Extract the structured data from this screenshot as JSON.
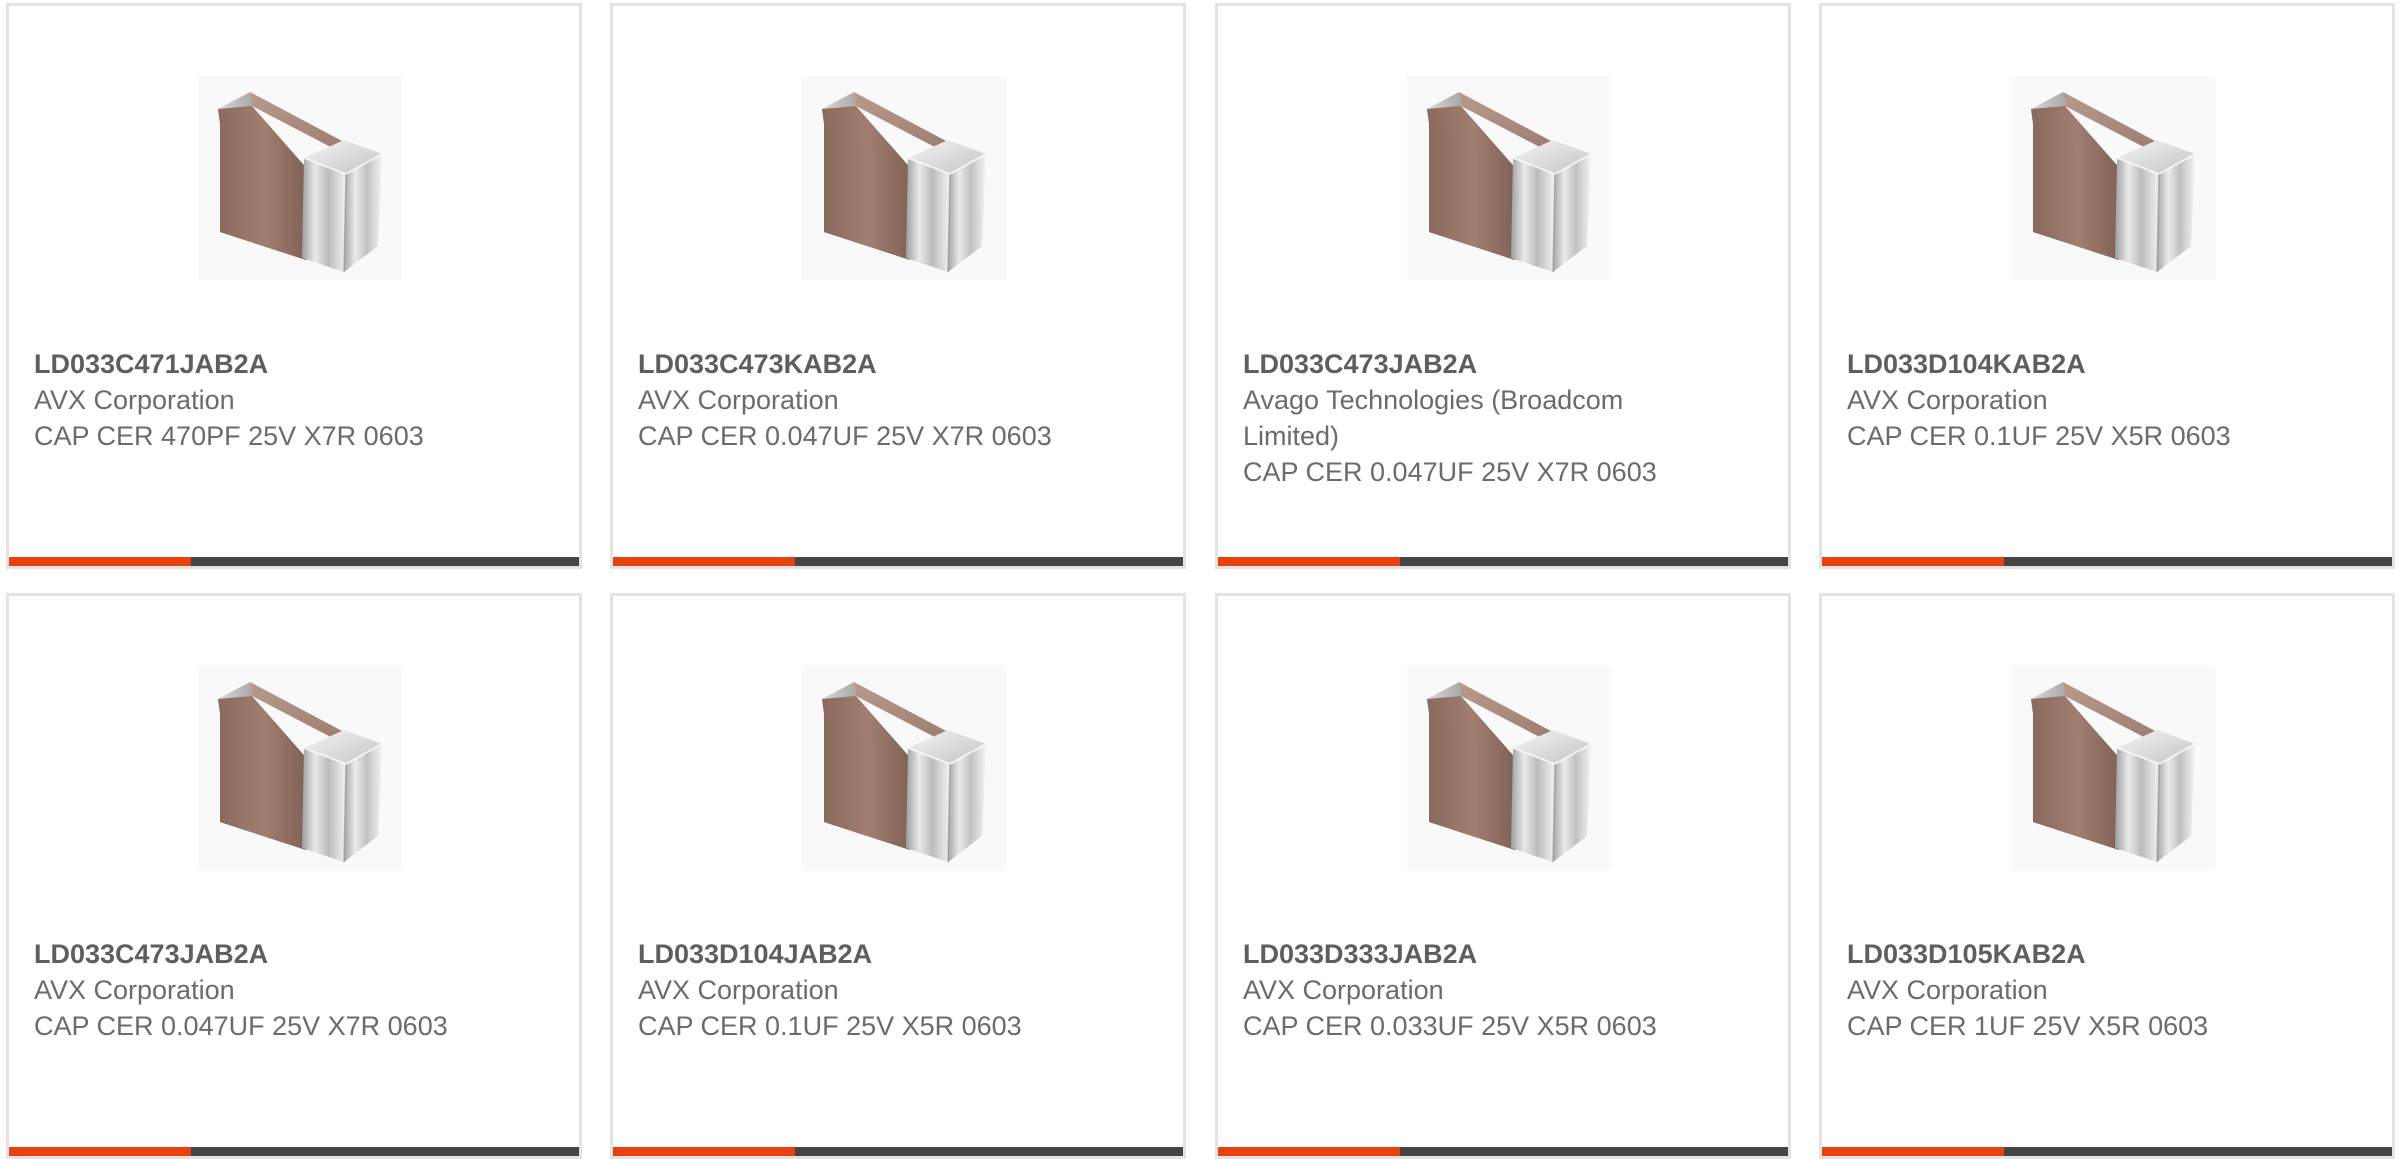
{
  "colors": {
    "accent": "#e6410f",
    "bar_dark": "#454545",
    "card_border": "#e3e3e3",
    "text": "#6b6b6b"
  },
  "product_icon": "ceramic-capacitor-icon",
  "cards": [
    {
      "part_number": "LD033C471JAB2A",
      "manufacturer": "AVX Corporation",
      "description": "CAP CER 470PF 25V X7R 0603"
    },
    {
      "part_number": "LD033C473KAB2A",
      "manufacturer": "AVX Corporation",
      "description": "CAP CER 0.047UF 25V X7R 0603"
    },
    {
      "part_number": "LD033C473JAB2A",
      "manufacturer": "Avago Technologies (Broadcom Limited)",
      "description": "CAP CER 0.047UF 25V X7R 0603"
    },
    {
      "part_number": "LD033D104KAB2A",
      "manufacturer": "AVX Corporation",
      "description": "CAP CER 0.1UF 25V X5R 0603"
    },
    {
      "part_number": "LD033C473JAB2A",
      "manufacturer": "AVX Corporation",
      "description": "CAP CER 0.047UF 25V X7R 0603"
    },
    {
      "part_number": "LD033D104JAB2A",
      "manufacturer": "AVX Corporation",
      "description": "CAP CER 0.1UF 25V X5R 0603"
    },
    {
      "part_number": "LD033D333JAB2A",
      "manufacturer": "AVX Corporation",
      "description": "CAP CER 0.033UF 25V X5R 0603"
    },
    {
      "part_number": "LD033D105KAB2A",
      "manufacturer": "AVX Corporation",
      "description": "CAP CER 1UF 25V X5R 0603"
    }
  ]
}
